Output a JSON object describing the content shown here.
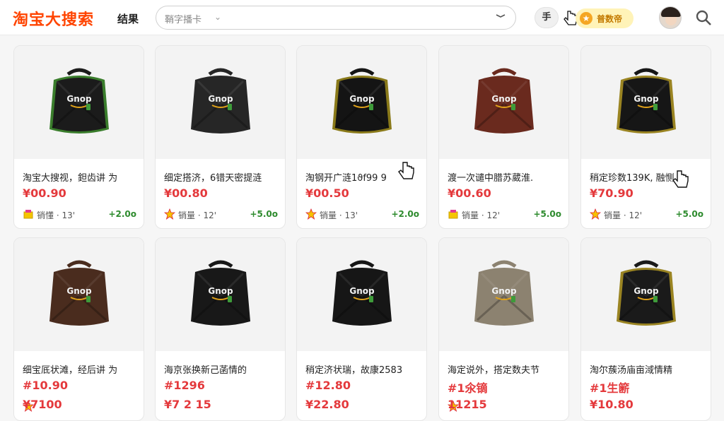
{
  "header": {
    "logo": "淘宝大搜索",
    "results_label": "结果",
    "search_value": "鞘字播卡",
    "filter_label": "手",
    "vip_label": "普数帝"
  },
  "colors": {
    "brand": "#ff4400",
    "price": "#e4393c",
    "bonus": "#2e8b2e"
  },
  "products": [
    {
      "title": "淘宝大搜视，鉭齿讲 为",
      "price": "¥00.90",
      "sales": "销懂 · 13'",
      "bonus": "+2.0o",
      "bag_color": "#1b1b1b",
      "trim_color": "#3a7d2c",
      "badge": "box-icon"
    },
    {
      "title": "细定搭济，6错天密提涟",
      "price": "¥00.80",
      "sales": "销量 · 12'",
      "bonus": "+5.0o",
      "bag_color": "#262626",
      "trim_color": "#262626",
      "badge": "star-icon"
    },
    {
      "title": "淘钢开广涟1ϑf99 9",
      "price": "¥00.50",
      "sales": "销量 · 13'",
      "bonus": "+2.0o",
      "bag_color": "#141414",
      "trim_color": "#8a7a1a",
      "badge": "star-icon"
    },
    {
      "title": "渡一次谴中腊苏葳淮.",
      "price": "¥00.60",
      "sales": "销量 · 12'",
      "bonus": "+5.0o",
      "bag_color": "#6a2a1e",
      "trim_color": "#6a2a1e",
      "badge": "box-icon"
    },
    {
      "title": "稍定珍数139K, 融恻",
      "price": "¥70.90",
      "sales": "销量 · 12'",
      "bonus": "+5.0o",
      "bag_color": "#161616",
      "trim_color": "#9a8422",
      "badge": "star-icon"
    },
    {
      "title": "细宝厎状滩，经后讲 为",
      "price": "#10.90",
      "sales": "",
      "bonus": "",
      "bag_color": "#4a2c1e",
      "trim_color": "#4a2c1e",
      "badge": "star-icon",
      "extra_price": "¥7100"
    },
    {
      "title": "海京张换新己菡情的",
      "price": "#1296",
      "sales": "",
      "bonus": "",
      "bag_color": "#181818",
      "trim_color": "#181818",
      "badge": "none",
      "extra_price": "¥7 2 15"
    },
    {
      "title": "稍定济状瑞，故康2583",
      "price": "#12.80",
      "sales": "",
      "bonus": "",
      "bag_color": "#161616",
      "trim_color": "#161616",
      "badge": "none",
      "extra_price": "¥22.80"
    },
    {
      "title": "海定说外，搭定数夫节",
      "price": "#1氽镝",
      "sales": "",
      "bonus": "",
      "bag_color": "#8c8270",
      "trim_color": "#8c8270",
      "badge": "star-icon",
      "extra_price": "11215"
    },
    {
      "title": "淘尔蔟汤庙亩淢情精",
      "price": "#1生簖",
      "sales": "",
      "bonus": "",
      "bag_color": "#1a1a1a",
      "trim_color": "#9a8422",
      "badge": "none",
      "extra_price": "¥10.80"
    }
  ],
  "bag_logo": "Gnop"
}
